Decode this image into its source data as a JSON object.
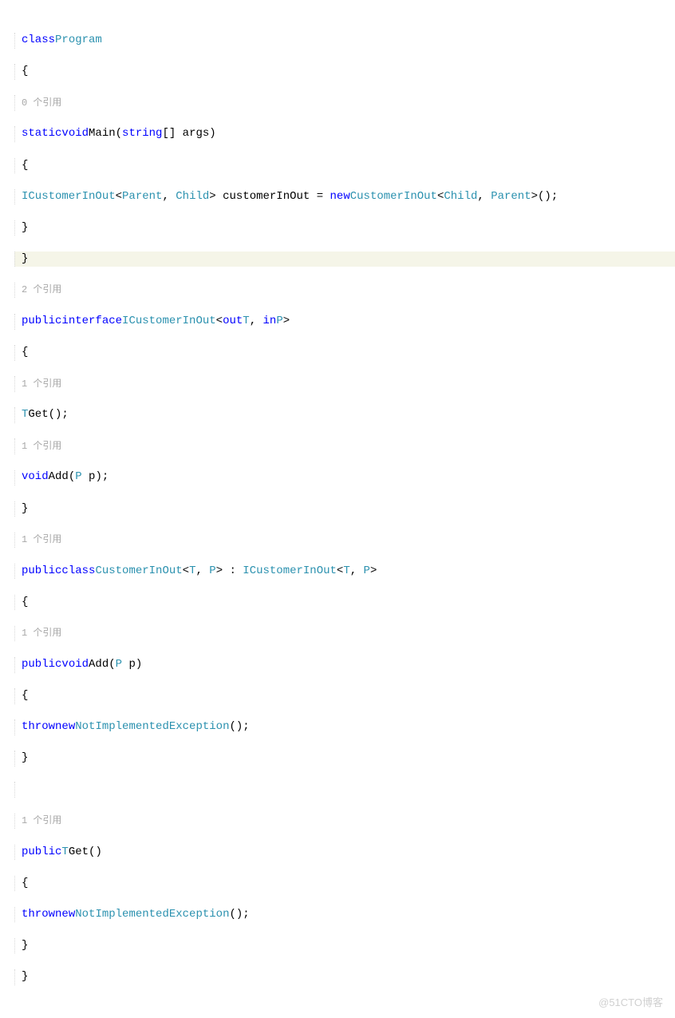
{
  "code": {
    "line1_class": "class",
    "line1_program": "Program",
    "line2_brace": "{",
    "line3_ref": "0 个引用",
    "line4_static": "static",
    "line4_void": "void",
    "line4_main": "Main",
    "line4_string": "string",
    "line4_args": "[] args)",
    "line5_brace": "{",
    "line6_icustomer": "ICustomerInOut",
    "line6_parent1": "Parent",
    "line6_child1": "Child",
    "line6_var": "> customerInOut = ",
    "line6_new": "new",
    "line6_customer": "CustomerInOut",
    "line6_child2": "Child",
    "line6_parent2": "Parent",
    "line6_end": ">();",
    "line7_brace": "}",
    "line8_brace": "}",
    "line9_ref": "2 个引用",
    "line10_public": "public",
    "line10_interface": "interface",
    "line10_name": "ICustomerInOut",
    "line10_out": "out",
    "line10_t": "T",
    "line10_in": "in",
    "line10_p": "P",
    "line11_brace": "{",
    "line12_ref": "1 个引用",
    "line13_t": "T",
    "line13_get": "Get",
    "line13_end": "();",
    "line14_ref": "1 个引用",
    "line15_void": "void",
    "line15_add": "Add",
    "line15_p": "P",
    "line15_end": " p);",
    "line16_brace": "}",
    "line17_ref": "1 个引用",
    "line18_public": "public",
    "line18_class": "class",
    "line18_name": "CustomerInOut",
    "line18_t1": "T",
    "line18_p1": "P",
    "line18_colon": "> : ",
    "line18_iface": "ICustomerInOut",
    "line18_t2": "T",
    "line18_p2": "P",
    "line19_brace": "{",
    "line20_ref": "1 个引用",
    "line21_public": "public",
    "line21_void": "void",
    "line21_add": "Add",
    "line21_p": "P",
    "line21_end": " p)",
    "line22_brace": "{",
    "line23_throw": "throw",
    "line23_new": "new",
    "line23_exc": "NotImplementedException",
    "line23_end": "();",
    "line24_brace": "}",
    "line25_blank": "",
    "line26_ref": "1 个引用",
    "line27_public": "public",
    "line27_t": "T",
    "line27_get": "Get",
    "line27_end": "()",
    "line28_brace": "{",
    "line29_throw": "throw",
    "line29_new": "new",
    "line29_exc": "NotImplementedException",
    "line29_end": "();",
    "line30_brace": "}",
    "line31_brace": "}"
  },
  "watermark": "@51CTO博客"
}
